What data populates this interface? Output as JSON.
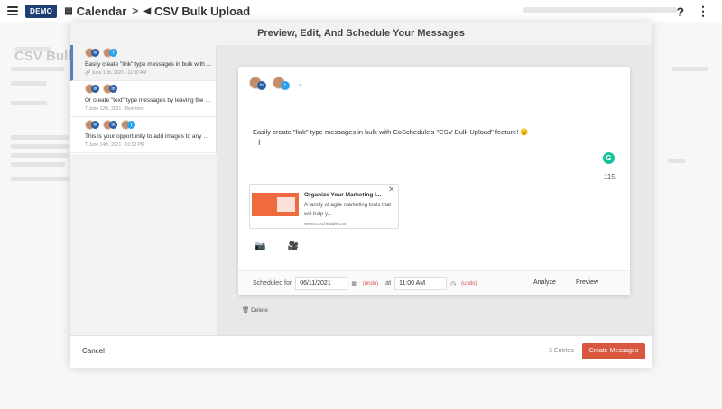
{
  "topbar": {
    "badge": "DEMO",
    "crumb_calendar": "Calendar",
    "crumb_upload": "CSV Bulk Upload",
    "help": "?"
  },
  "background": {
    "title": "CSV Bulk U"
  },
  "modal": {
    "title": "Preview, Edit, And Schedule Your Messages",
    "messages": [
      {
        "text": "Easily create \"link\" type messages in bulk with ...",
        "meta": "June 11th, 2021 · 11:00 AM",
        "networks": [
          "linkedin",
          "twitter"
        ]
      },
      {
        "text": "Or create \"text\" type messages by leaving the \"li...",
        "meta": "June 12th, 2021 · Best time",
        "networks": [
          "linkedin",
          "linkedin"
        ]
      },
      {
        "text": "This is your opportunity to add images to any of ...",
        "meta": "June 14th, 2021 · 01:00 PM",
        "networks": [
          "linkedin",
          "linkedin",
          "twitter"
        ]
      }
    ],
    "editor": {
      "message": "Easily create \"link\" type messages in bulk with CoSchedule's \"CSV Bulk Upload\" feature!",
      "emoji": "😉",
      "grammarly": "G",
      "char_count": "115",
      "link_preview": {
        "title": "Organize Your Marketing I...",
        "description": "A family of agile marketing tools that will help y...",
        "url": "www.coschedule.com"
      },
      "scheduled_label": "Scheduled for",
      "date": "06/11/2021",
      "undo": "(undo)",
      "at_label": "at",
      "time": "11:00 AM",
      "analyze": "Analyze",
      "preview": "Preview"
    },
    "delete_label": "Delete",
    "footer": {
      "cancel": "Cancel",
      "entries": "3 Entries",
      "create": "Create Messages"
    }
  },
  "colors": {
    "badge": "#1d3f73",
    "create_button": "#d9573f",
    "undo": "#d9534f",
    "linkedin": "#2b5fa5",
    "twitter": "#2aa3ef"
  }
}
